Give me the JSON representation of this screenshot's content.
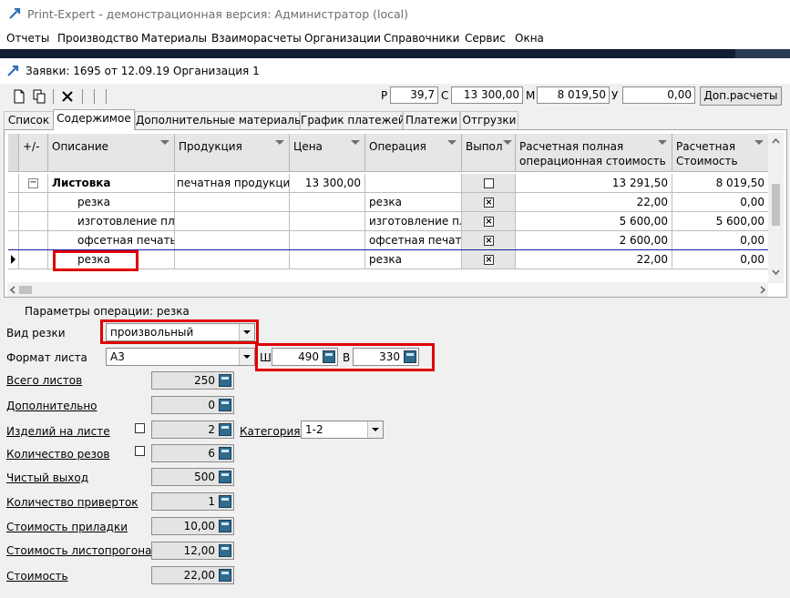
{
  "window": {
    "title": "Print-Expert - демонстрационная версия: Администратор (local)"
  },
  "menu": [
    "Отчеты",
    "Производство",
    "Материалы",
    "Взаиморасчеты",
    "Организации",
    "Справочники",
    "Сервис",
    "Окна"
  ],
  "child": {
    "title": "Заявки: 1695 от 12.09.19  Организация 1"
  },
  "totals": {
    "r_label": "Р",
    "r_value": "39,7",
    "c_label": "С",
    "c_value": "13 300,00",
    "m_label": "М",
    "m_value": "8 019,50",
    "u_label": "У",
    "u_value": "0,00",
    "extra_button": "Доп.расчеты"
  },
  "tabs": [
    "Список",
    "Содержимое",
    "Дополнительные материалы",
    "График платежей",
    "Платежи",
    "Отгрузки"
  ],
  "active_tab": "Содержимое",
  "grid": {
    "headers": {
      "expand": "+/-",
      "description": "Описание",
      "product": "Продукция",
      "price": "Цена",
      "operation": "Операция",
      "done": "Выпол",
      "full_cost": "Расчетная полная операционная стоимость",
      "cost": "Расчетная Стоимость"
    },
    "rows": [
      {
        "expand": "−",
        "description": "Листовка",
        "product": "печатная продукция",
        "price": "13 300,00",
        "operation": "",
        "done": false,
        "full_cost": "13 291,50",
        "cost": "8 019,50"
      },
      {
        "expand": "",
        "description": "резка",
        "product": "",
        "price": "",
        "operation": "резка",
        "done": true,
        "full_cost": "22,00",
        "cost": "0,00"
      },
      {
        "expand": "",
        "description": "изготовление пла",
        "product": "",
        "price": "",
        "operation": "изготовление пла",
        "done": true,
        "full_cost": "5 600,00",
        "cost": "5 600,00"
      },
      {
        "expand": "",
        "description": "офсетная печать",
        "product": "",
        "price": "",
        "operation": "офсетная печать",
        "done": true,
        "full_cost": "2 600,00",
        "cost": "0,00"
      },
      {
        "expand": "",
        "description": "резка",
        "product": "",
        "price": "",
        "operation": "резка",
        "done": true,
        "full_cost": "22,00",
        "cost": "0,00"
      }
    ]
  },
  "params": {
    "title": "Параметры операции: резка",
    "cut_type_label": "Вид резки",
    "cut_type_value": "произвольный",
    "format_label": "Формат листа",
    "format_value": "А3",
    "width_label": "Ш",
    "width_value": "490",
    "height_label": "В",
    "height_value": "330",
    "total_sheets_label": "Всего листов",
    "total_sheets": "250",
    "additional_label": "Дополнительно",
    "additional": "0",
    "items_label": "Изделий на листе",
    "items": "2",
    "category_label": "Категория",
    "category_value": "1-2",
    "cuts_label": "Количество резов",
    "cuts": "6",
    "net_output_label": "Чистый выход",
    "net_output": "500",
    "makeready_count_label": "Количество приверток",
    "makeready_count": "1",
    "makeready_cost_label": "Стоимость приладки",
    "makeready_cost": "10,00",
    "sheet_run_cost_label": "Стоимость листопрогона",
    "sheet_run_cost": "12,00",
    "cost_label": "Стоимость",
    "cost": "22,00"
  }
}
